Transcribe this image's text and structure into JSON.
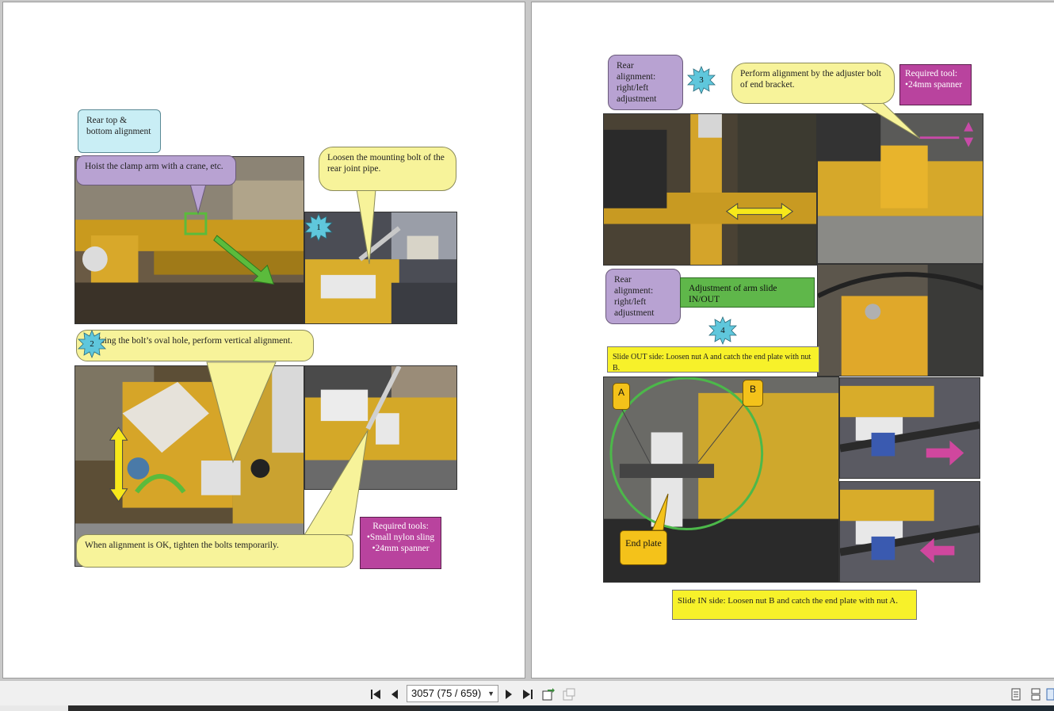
{
  "left_page": {
    "callout_rear_top": "Rear top & bottom alignment",
    "callout_hoist": "Hoist the clamp arm with a crane, etc.",
    "callout_loosen": "Loosen the mounting bolt of the rear joint pipe.",
    "callout_oval": "Using the bolt’s oval hole, perform vertical alignment.",
    "callout_tighten": "When alignment is OK, tighten the bolts temporarily.",
    "tools_title": "Required tools:",
    "tools_item_1": "•Small nylon sling",
    "tools_item_2": "•24mm spanner",
    "badge_1": "1",
    "badge_2": "2"
  },
  "right_page": {
    "callout_rear_lr_1": "Rear alignment: right/left adjustment",
    "callout_adjuster": "Perform alignment by the adjuster bolt of end bracket.",
    "tool_title": "Required tool:",
    "tool_item": "•24mm spanner",
    "callout_rear_lr_2": "Rear alignment: right/left adjustment",
    "callout_arm_slide": "Adjustment of arm slide IN/OUT",
    "slide_out": "Slide OUT side: Loosen nut A and catch the end plate with nut B.",
    "slide_in": "Slide IN side: Loosen nut B and catch the end plate with nut A.",
    "label_a": "A",
    "label_b": "B",
    "label_end_plate": "End plate",
    "badge_3": "3",
    "badge_4": "4"
  },
  "toolbar": {
    "page_indicator": "3057 (75 / 659)",
    "first_icon": "first-page-icon",
    "prev_icon": "previous-page-icon",
    "next_icon": "next-page-icon",
    "last_icon": "last-page-icon"
  },
  "colors": {
    "callout_yellow": "#f7f39a",
    "callout_purple": "#b8a2d2",
    "callout_cyan": "#c9eef5",
    "tools_magenta": "#b9439e",
    "arm_slide_green": "#5fb74a",
    "slide_box_yellow": "#f7f12a"
  }
}
